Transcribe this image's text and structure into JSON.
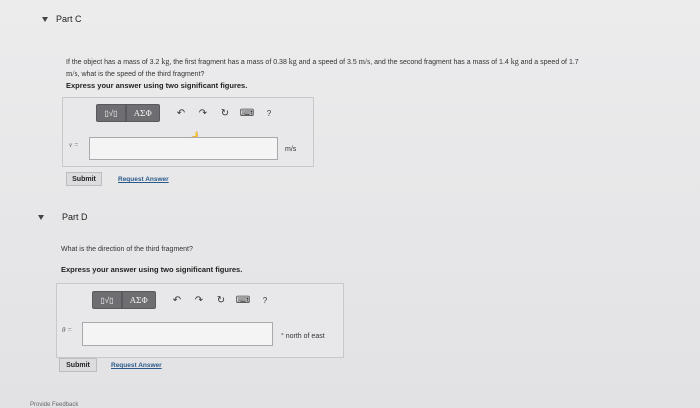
{
  "part_c": {
    "title": "Part C",
    "question_line1_pre": "If the object has a mass of 3.2 ",
    "question_line1_mass_unit": "kg",
    "question_line1_mid": ", the first fragment has a mass of 0.38 ",
    "question_line1_mass_unit2": "kg",
    "question_line1_mid2": " and a speed of 3.5 ",
    "question_line1_speed_unit": "m/s",
    "question_line1_mid3": ", and the second fragment has a mass of 1.4 ",
    "question_line1_mass_unit3": "kg",
    "question_line1_end": " and a speed of 1.7",
    "question_line2_unit": "m/s",
    "question_line2_end": ", what is the speed of the third fragment?",
    "instruction": "Express your answer using two significant figures.",
    "variable": "v =",
    "unit": "m/s",
    "submit_label": "Submit",
    "request_label": "Request Answer"
  },
  "part_d": {
    "title": "Part D",
    "question": "What is the direction of the third fragment?",
    "instruction": "Express your answer using two significant figures.",
    "variable": "θ =",
    "unit": "° north of east",
    "submit_label": "Submit",
    "request_label": "Request Answer"
  },
  "toolbar": {
    "templates_label": "▯√▯",
    "greek_label": "ΑΣΦ",
    "undo_icon": "↶",
    "redo_icon": "↷",
    "reset_icon": "↻",
    "keyboard_icon": "⌨",
    "help_label": "?"
  },
  "footer": {
    "partial_text": "Provide Feedback"
  }
}
